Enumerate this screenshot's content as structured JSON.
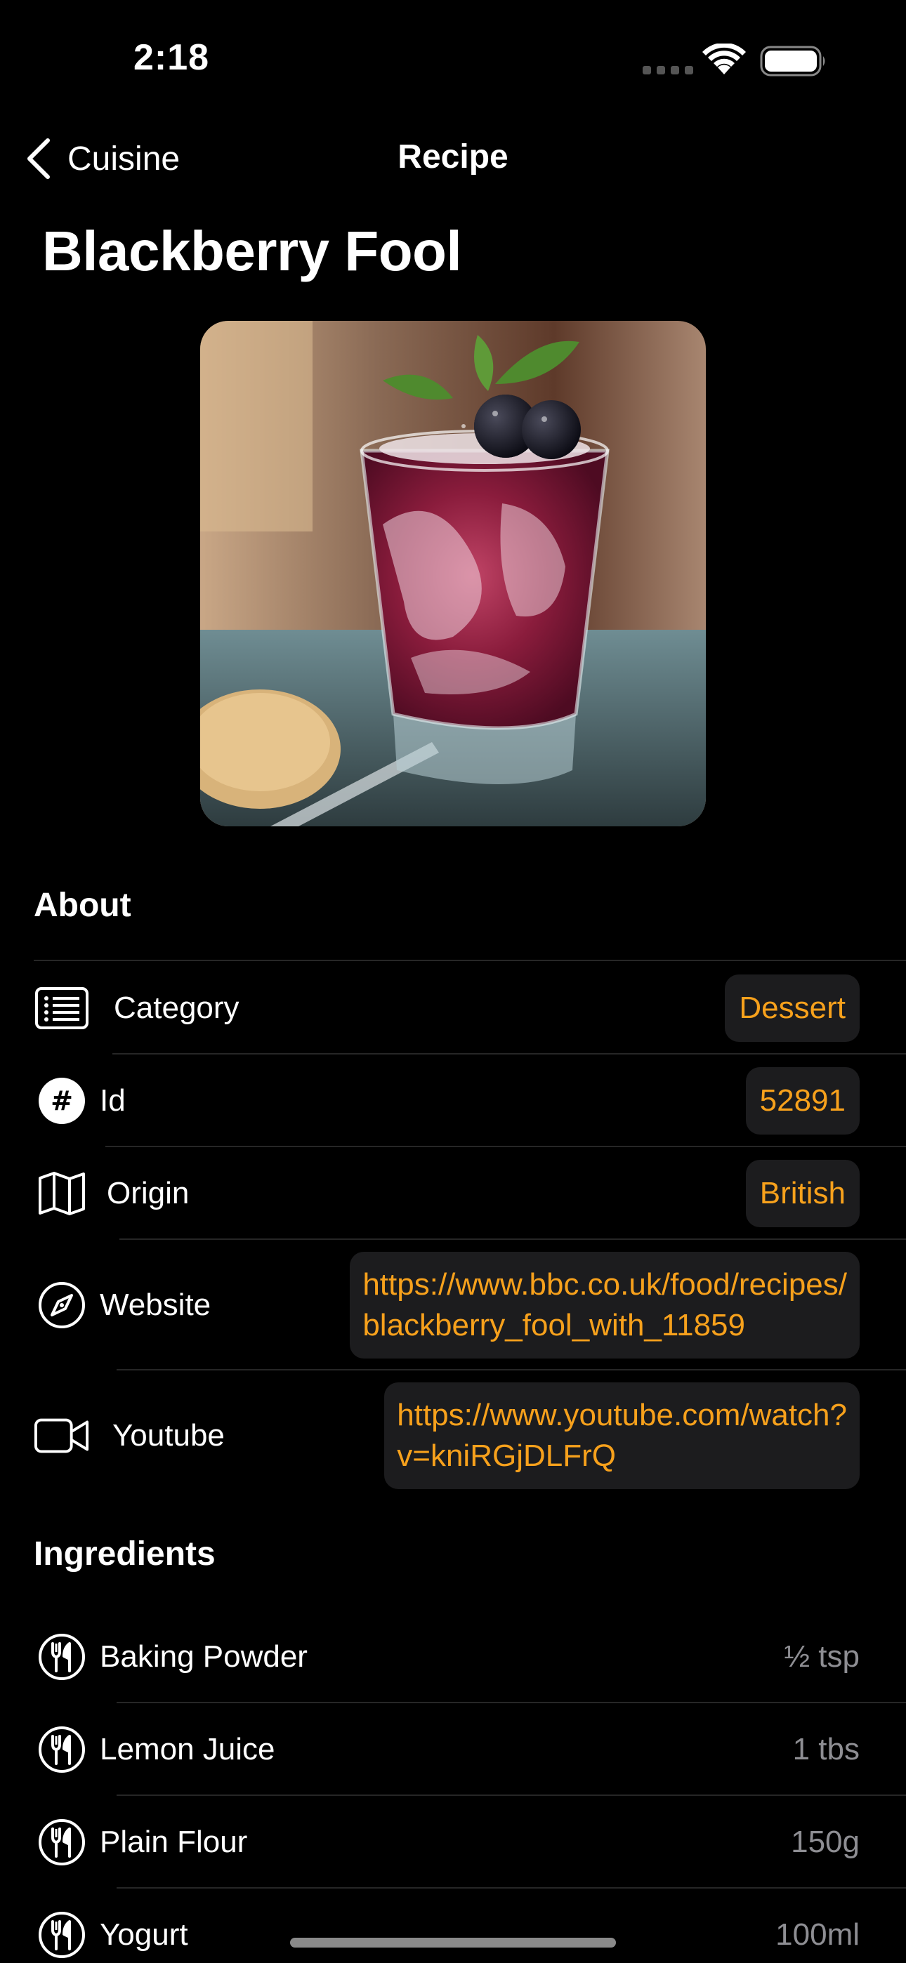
{
  "status_bar": {
    "time": "2:18"
  },
  "nav": {
    "back_label": "Cuisine",
    "title": "Recipe"
  },
  "recipe": {
    "name": "Blackberry Fool",
    "image_alt": "Blackberry fool dessert in a glass topped with blackberries and mint"
  },
  "about": {
    "header": "About",
    "rows": [
      {
        "label": "Category",
        "value": "Dessert",
        "icon": "list-icon"
      },
      {
        "label": "Id",
        "value": "52891",
        "icon": "number-icon"
      },
      {
        "label": "Origin",
        "value": "British",
        "icon": "map-icon"
      },
      {
        "label": "Website",
        "value_line1": "https://www.bbc.co.uk/food/recipes/",
        "value_line2": "blackberry_fool_with_11859",
        "icon": "compass-icon"
      },
      {
        "label": "Youtube",
        "value_line1": "https://www.youtube.com/watch?",
        "value_line2": "v=kniRGjDLFrQ",
        "icon": "video-icon"
      }
    ]
  },
  "ingredients": {
    "header": "Ingredients",
    "items": [
      {
        "name": "Baking Powder",
        "measure": "½ tsp",
        "icon": "fork-knife-icon"
      },
      {
        "name": "Lemon Juice",
        "measure": "1 tbs",
        "icon": "fork-knife-icon"
      },
      {
        "name": "Plain Flour",
        "measure": "150g",
        "icon": "fork-knife-icon"
      },
      {
        "name": "Yogurt",
        "measure": "100ml",
        "icon": "fork-knife-icon"
      }
    ]
  },
  "colors": {
    "accent": "#f7a11c",
    "background": "#000000",
    "pill": "#1c1c1e",
    "secondary": "#8e8e93"
  }
}
